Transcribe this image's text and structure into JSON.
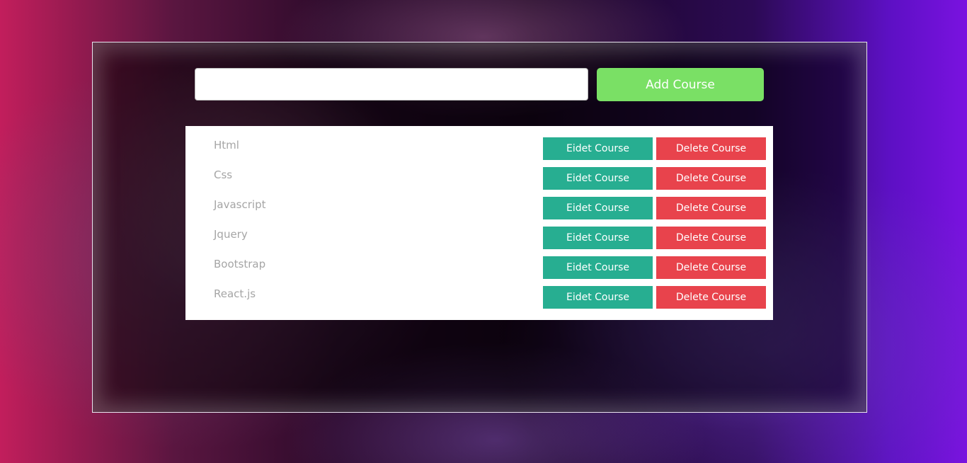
{
  "form": {
    "input_value": "",
    "add_button_label": "Add Course"
  },
  "courses": [
    {
      "name": "Html",
      "edit_label": "Eidet Course",
      "delete_label": "Delete Course"
    },
    {
      "name": "Css",
      "edit_label": "Eidet Course",
      "delete_label": "Delete Course"
    },
    {
      "name": "Javascript",
      "edit_label": "Eidet Course",
      "delete_label": "Delete Course"
    },
    {
      "name": "Jquery",
      "edit_label": "Eidet Course",
      "delete_label": "Delete Course"
    },
    {
      "name": "Bootstrap",
      "edit_label": "Eidet Course",
      "delete_label": "Delete Course"
    },
    {
      "name": "React.js",
      "edit_label": "Eidet Course",
      "delete_label": "Delete Course"
    }
  ],
  "colors": {
    "add_button": "#7ae065",
    "edit_button": "#27ae91",
    "delete_button": "#e8434c",
    "course_text": "#a5a5a5"
  }
}
